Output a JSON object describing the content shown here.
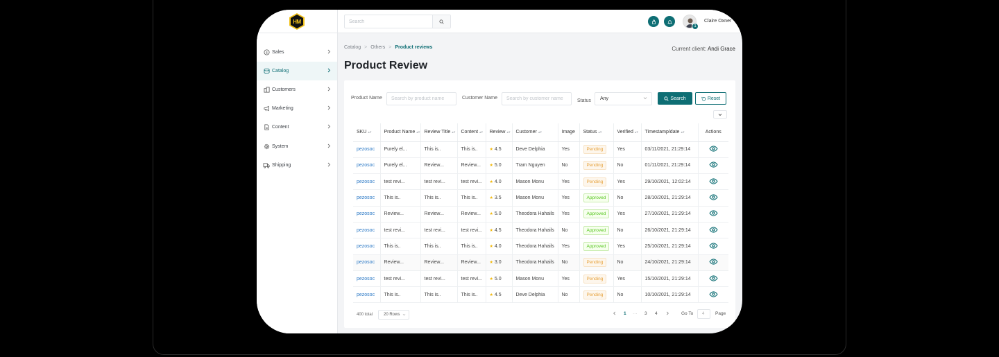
{
  "header": {
    "logo_text": "HM",
    "search_placeholder": "Search",
    "user_name": "Claire Oxner",
    "avatar_badge": "1"
  },
  "sidebar": {
    "items": [
      {
        "label": "Sales",
        "icon": "dollar-circle-icon",
        "active": false
      },
      {
        "label": "Catalog",
        "icon": "catalog-icon",
        "active": true
      },
      {
        "label": "Customers",
        "icon": "building-icon",
        "active": false
      },
      {
        "label": "Marketing",
        "icon": "megaphone-icon",
        "active": false
      },
      {
        "label": "Content",
        "icon": "document-icon",
        "active": false
      },
      {
        "label": "System",
        "icon": "gear-icon",
        "active": false
      },
      {
        "label": "Shipping",
        "icon": "truck-icon",
        "active": false
      }
    ]
  },
  "breadcrumb": [
    "Catalog",
    "Others",
    "Product reviews"
  ],
  "client": {
    "label": "Current client:",
    "name": "Andi Grace"
  },
  "page_title": "Product Review",
  "filters": {
    "product_name_label": "Product Name",
    "product_name_placeholder": "Search by product name",
    "customer_name_label": "Customer Name",
    "customer_name_placeholder": "Search by customer name",
    "status_label": "Status",
    "status_value": "Any",
    "search_button": "Search",
    "reset_button": "Reset"
  },
  "table": {
    "columns": [
      "SKU",
      "Product Name",
      "Review Title",
      "Content",
      "Review",
      "Customer",
      "Image",
      "Status",
      "Verified",
      "Timestamp/date",
      "Actions"
    ],
    "rows": [
      {
        "sku": "pezosoc",
        "product": "Purely el...",
        "title": "This is..",
        "content": "This is..",
        "review": "4.5",
        "customer": "Deve Delphia",
        "image": "Yes",
        "status": "Pending",
        "verified": "Yes",
        "timestamp": "03/11/2021, 21:29:14"
      },
      {
        "sku": "pezosoc",
        "product": "Purely el...",
        "title": "Review...",
        "content": "Review...",
        "review": "5.0",
        "customer": "Tram Nguyen",
        "image": "No",
        "status": "Pending",
        "verified": "No",
        "timestamp": "01/11/2021, 21:29:14"
      },
      {
        "sku": "pezosoc",
        "product": "test revi...",
        "title": "test revi...",
        "content": "test revi...",
        "review": "4.0",
        "customer": "Mason Monu",
        "image": "Yes",
        "status": "Pending",
        "verified": "Yes",
        "timestamp": "29/10/2021, 12:02:14"
      },
      {
        "sku": "pezosoc",
        "product": "This is..",
        "title": "This is..",
        "content": "This is..",
        "review": "3.5",
        "customer": "Mason Monu",
        "image": "Yes",
        "status": "Approved",
        "verified": "No",
        "timestamp": "28/10/2021, 21:29:14"
      },
      {
        "sku": "pezosoc",
        "product": "Review...",
        "title": "Review...",
        "content": "Review...",
        "review": "5.0",
        "customer": "Theodora Hahails",
        "image": "Yes",
        "status": "Approved",
        "verified": "Yes",
        "timestamp": "27/10/2021, 21:29:14"
      },
      {
        "sku": "pezosoc",
        "product": "test revi...",
        "title": "test revi...",
        "content": "test revi...",
        "review": "4.5",
        "customer": "Theodora Hahails",
        "image": "No",
        "status": "Approved",
        "verified": "No",
        "timestamp": "26/10/2021, 21:29:14"
      },
      {
        "sku": "pezosoc",
        "product": "This is..",
        "title": "This is..",
        "content": "This is..",
        "review": "4.0",
        "customer": "Theodora Hahails",
        "image": "Yes",
        "status": "Approved",
        "verified": "Yes",
        "timestamp": "25/10/2021, 21:29:14"
      },
      {
        "sku": "pezosoc",
        "product": "Review...",
        "title": "Review...",
        "content": "Review...",
        "review": "3.0",
        "customer": "Theodora Hahails",
        "image": "No",
        "status": "Pending",
        "verified": "No",
        "timestamp": "24/10/2021, 21:29:14"
      },
      {
        "sku": "pezosoc",
        "product": "test revi...",
        "title": "test revi...",
        "content": "test revi...",
        "review": "5.0",
        "customer": "Mason Monu",
        "image": "Yes",
        "status": "Pending",
        "verified": "Yes",
        "timestamp": "15/10/2021, 21:29:14"
      },
      {
        "sku": "pezosoc",
        "product": "This is..",
        "title": "This is..",
        "content": "This is..",
        "review": "4.5",
        "customer": "Deve Delphia",
        "image": "No",
        "status": "Pending",
        "verified": "No",
        "timestamp": "10/10/2021, 21:29:14"
      }
    ]
  },
  "footer": {
    "total": "400 total",
    "rows_per_page": "20 Rows",
    "pages": [
      "1",
      "···",
      "3",
      "4"
    ],
    "goto_label": "Go To",
    "goto_value": "4",
    "page_label": "Page"
  },
  "colors": {
    "accent": "#0e6e74",
    "link": "#2a78c5",
    "pending": "#e6a23c",
    "approved": "#52c41a",
    "star": "#f2b705"
  }
}
